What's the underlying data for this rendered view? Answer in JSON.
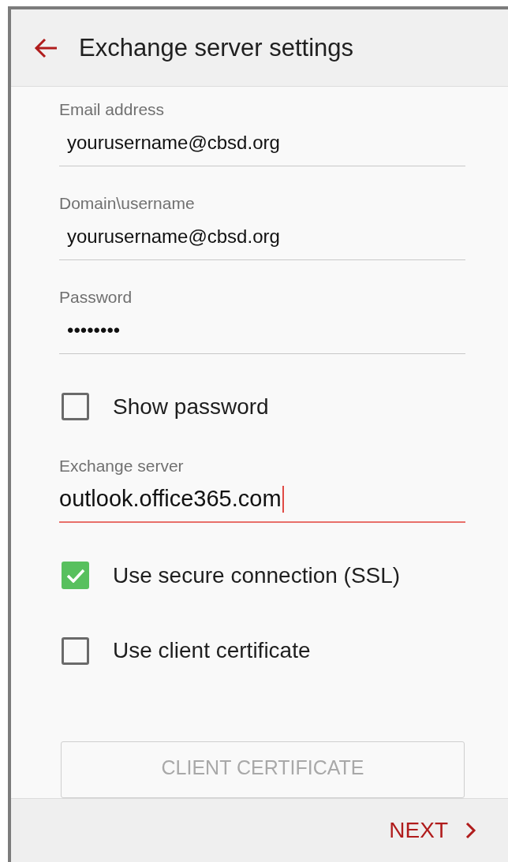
{
  "header": {
    "title": "Exchange server settings"
  },
  "form": [
    {
      "kind": "field",
      "label": "Email address",
      "value": "yourusername@cbsd.org",
      "focused": false
    },
    {
      "kind": "field",
      "label": "Domain\\username",
      "value": "yourusername@cbsd.org",
      "focused": false
    },
    {
      "kind": "field",
      "label": "Password",
      "value": "••••••••",
      "focused": false
    },
    {
      "kind": "checkbox",
      "label": "Show password",
      "checked": false
    },
    {
      "kind": "field",
      "label": "Exchange server",
      "value": "outlook.office365.com",
      "focused": true
    },
    {
      "kind": "checkbox",
      "label": "Use secure connection (SSL)",
      "checked": true
    },
    {
      "kind": "checkbox",
      "label": "Use client certificate",
      "checked": false
    },
    {
      "kind": "button",
      "label": "CLIENT CERTIFICATE",
      "disabled": true
    }
  ],
  "footer": {
    "next": "NEXT"
  }
}
